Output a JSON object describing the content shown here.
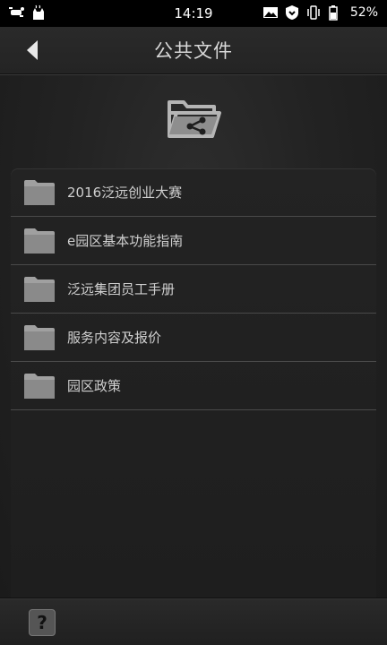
{
  "status_bar": {
    "time": "14:19",
    "battery": "52%",
    "left_icons": [
      "bug-notification-icon",
      "cat-notification-icon"
    ],
    "right_icons": [
      "image-icon",
      "shield-icon",
      "vibrate-icon",
      "battery-icon"
    ]
  },
  "header": {
    "title": "公共文件",
    "back_icon": "back-arrow-icon"
  },
  "shared_folder_icon": "shared-folder-icon",
  "folders": [
    {
      "label": "2016泛远创业大赛"
    },
    {
      "label": "e园区基本功能指南"
    },
    {
      "label": "泛远集团员工手册"
    },
    {
      "label": "服务内容及报价"
    },
    {
      "label": "园区政策"
    }
  ],
  "bottom_bar": {
    "help_label": "?"
  },
  "colors": {
    "background": "#1c1c1c",
    "folder": "#9a9a9a",
    "divider": "#4a4a4a",
    "text": "#cfcfcf"
  }
}
